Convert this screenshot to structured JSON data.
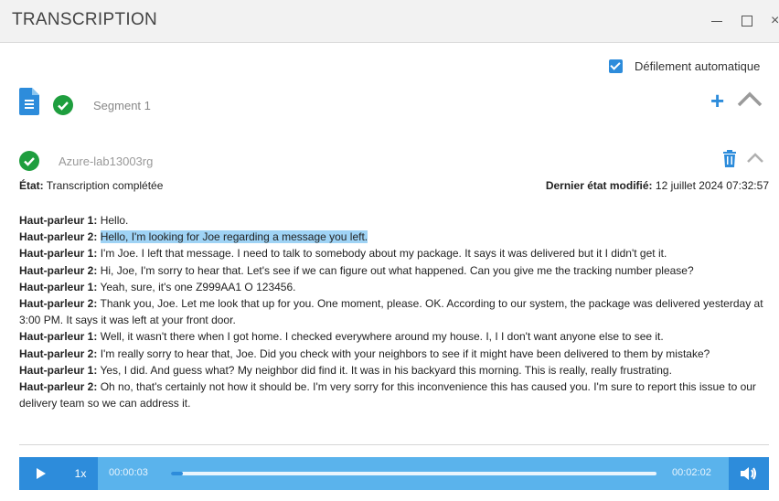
{
  "window": {
    "title": "TRANSCRIPTION",
    "close_glyph": "×"
  },
  "auto_scroll": {
    "label": "Défilement automatique",
    "checked": true
  },
  "segment": {
    "label": "Segment 1",
    "add_glyph": "+"
  },
  "job": {
    "name": "Azure-lab13003rg"
  },
  "status": {
    "state_label": "État:",
    "state_value": "Transcription complétée",
    "modified_label": "Dernier état modifié:",
    "modified_value": "12 juillet 2024 07:32:57"
  },
  "transcript": [
    {
      "speaker": "Haut-parleur 1:",
      "text": "Hello."
    },
    {
      "speaker": "Haut-parleur 2:",
      "text": "Hello, I'm looking for Joe regarding a message you left.",
      "highlighted": true
    },
    {
      "speaker": "Haut-parleur 1:",
      "text": "I'm Joe. I left that message. I need to talk to somebody about my package. It says it was delivered but it I didn't get it."
    },
    {
      "speaker": "Haut-parleur 2:",
      "text": "Hi, Joe, I'm sorry to hear that. Let's see if we can figure out what happened. Can you give me the tracking number please?"
    },
    {
      "speaker": "Haut-parleur 1:",
      "text": "Yeah, sure, it's one Z999AA1 O 123456."
    },
    {
      "speaker": "Haut-parleur 2:",
      "text": "Thank you, Joe. Let me look that up for you. One moment, please. OK. According to our system, the package was delivered yesterday at 3:00 PM. It says it was left at your front door."
    },
    {
      "speaker": "Haut-parleur 1:",
      "text": "Well, it wasn't there when I got home. I checked everywhere around my house. I, I I don't want anyone else to see it."
    },
    {
      "speaker": "Haut-parleur 2:",
      "text": "I'm really sorry to hear that, Joe. Did you check with your neighbors to see if it might have been delivered to them by mistake?"
    },
    {
      "speaker": "Haut-parleur 1:",
      "text": "Yes, I did. And guess what? My neighbor did find it. It was in his backyard this morning. This is really, really frustrating."
    },
    {
      "speaker": "Haut-parleur 2:",
      "text": "Oh no, that's certainly not how it should be. I'm very sorry for this inconvenience this has caused you. I'm sure to report this issue to our delivery team so we can address it."
    }
  ],
  "player": {
    "speed": "1x",
    "current_time": "00:00:03",
    "total_time": "00:02:02",
    "progress": 0.025
  },
  "colors": {
    "accent": "#2d8cdb",
    "player_bg": "#5ab3ec",
    "highlight": "#9fd3f5",
    "success": "#1e9e3e"
  },
  "icons": {
    "document": "document-icon",
    "check": "check-circle-icon",
    "plus": "plus-icon",
    "chevron": "chevron-up-icon",
    "trash": "trash-icon",
    "play": "play-icon",
    "volume": "volume-icon"
  }
}
